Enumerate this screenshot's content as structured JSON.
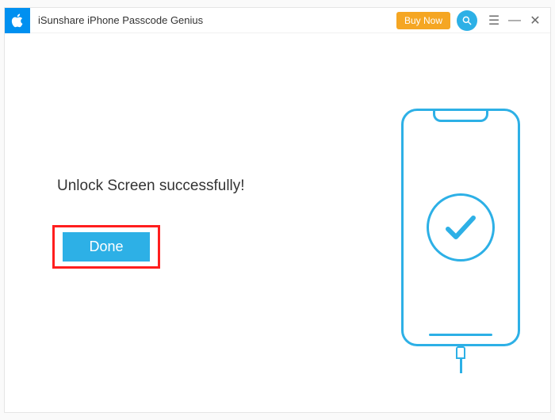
{
  "titlebar": {
    "app_title": "iSunshare iPhone Passcode Genius",
    "buy_now_label": "Buy Now"
  },
  "content": {
    "success_message": "Unlock Screen successfully!",
    "done_label": "Done"
  }
}
